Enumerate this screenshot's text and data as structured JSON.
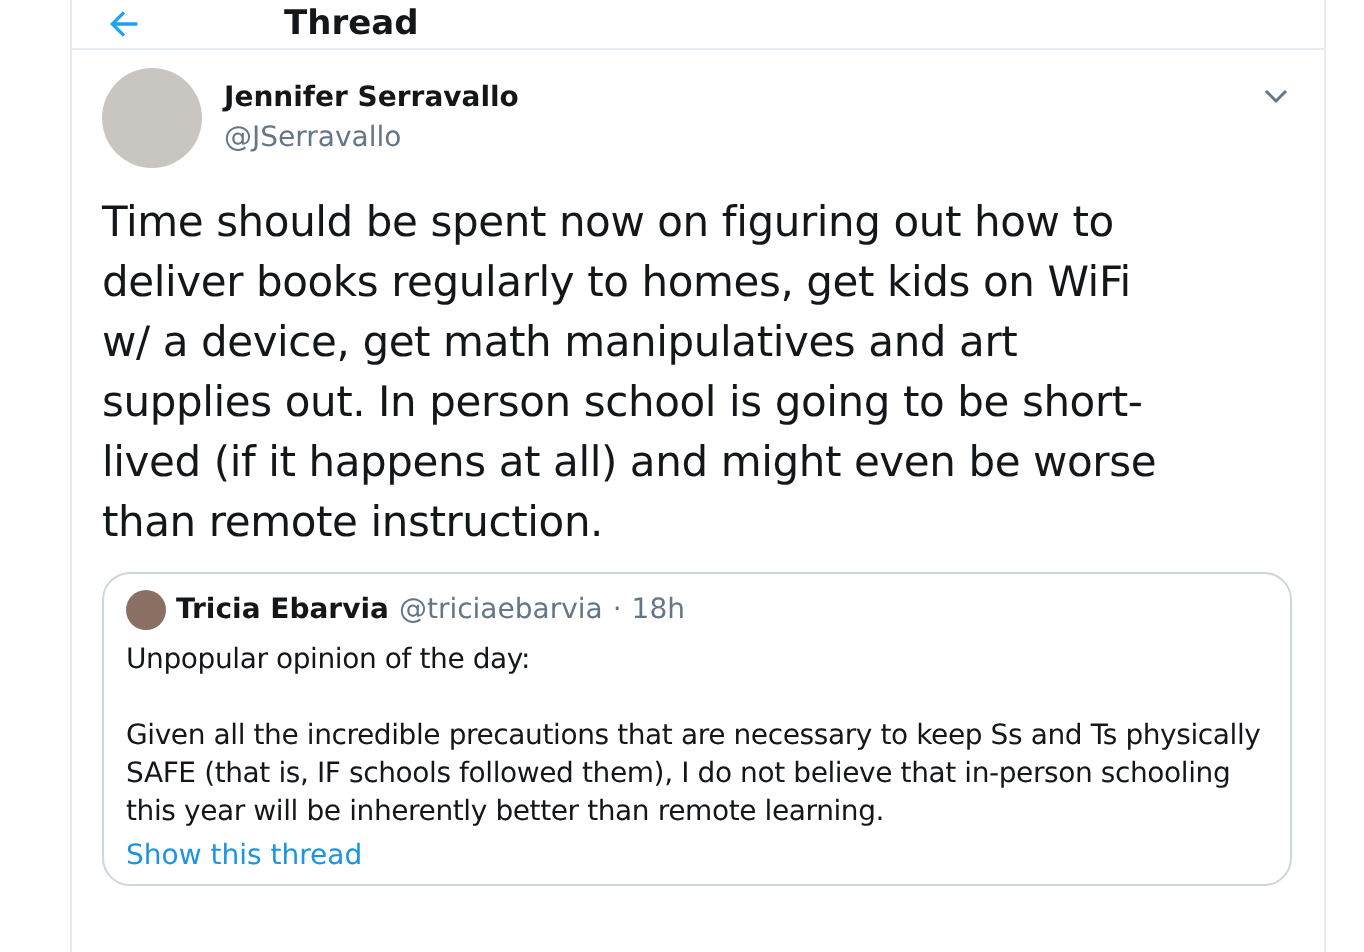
{
  "header": {
    "title": "Thread"
  },
  "tweet": {
    "name": "Jennifer Serravallo",
    "handle": "@JSerravallo",
    "text": "Time should be spent now on figuring out how to deliver books regularly to homes, get kids on WiFi w/ a device, get math manipulatives and art supplies out. In person school is going to be short-lived (if it happens at all) and might even be worse than remote instruction.",
    "quote": {
      "name": "Tricia Ebarvia",
      "handle": "@triciaebarvia",
      "separator": "·",
      "time": "18h",
      "paragraphs": [
        "Unpopular opinion of the day:",
        "Given all the incredible precautions that are necessary to keep Ss and Ts physically SAFE (that is, IF schools followed them), I do not believe that in-person schooling this year will be inherently better than remote learning."
      ],
      "link": "Show this thread"
    }
  }
}
